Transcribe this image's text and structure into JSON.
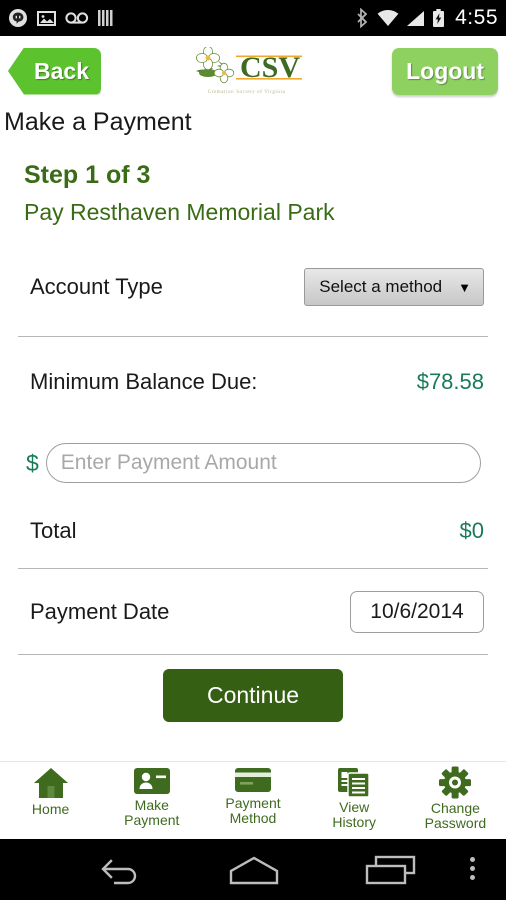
{
  "statusbar": {
    "time": "4:55",
    "left_icons": [
      "hangouts-icon",
      "image-icon",
      "voicemail-icon",
      "signal-bars-icon"
    ],
    "right_icons": [
      "bluetooth-icon",
      "wifi-icon",
      "cellular-signal-icon",
      "battery-charging-icon"
    ]
  },
  "header": {
    "back_label": "Back",
    "logout_label": "Logout",
    "logo_text": "CSV",
    "logo_subtitle": "Cremation Society of Virginia"
  },
  "page": {
    "title": "Make a Payment",
    "step": "Step 1 of 3",
    "subtitle": "Pay Resthaven Memorial Park"
  },
  "form": {
    "account_type_label": "Account Type",
    "account_type_value": "Select a method",
    "minimum_balance_label": "Minimum Balance Due:",
    "minimum_balance_value": "$78.58",
    "currency_symbol": "$",
    "amount_placeholder": "Enter Payment Amount",
    "amount_value": "",
    "total_label": "Total",
    "total_value": "$0",
    "payment_date_label": "Payment Date",
    "payment_date_value": "10/6/2014",
    "continue_label": "Continue"
  },
  "tabs": [
    {
      "label": "Home",
      "icon": "home-icon"
    },
    {
      "label": "Make\nPayment",
      "icon": "id-card-icon"
    },
    {
      "label": "Payment\nMethod",
      "icon": "credit-card-icon"
    },
    {
      "label": "View\nHistory",
      "icon": "documents-icon"
    },
    {
      "label": "Change\nPassword",
      "icon": "gear-icon"
    }
  ],
  "tab_labels": {
    "home": "Home",
    "make_payment_l1": "Make",
    "make_payment_l2": "Payment",
    "payment_method_l1": "Payment",
    "payment_method_l2": "Method",
    "view_history_l1": "View",
    "view_history_l2": "History",
    "change_password_l1": "Change",
    "change_password_l2": "Password"
  },
  "navbar": {
    "back": "back-icon",
    "home": "home-nav-icon",
    "recents": "recents-icon",
    "menu": "overflow-menu-icon"
  },
  "colors": {
    "brand_green": "#3a6b16",
    "accent_green": "#5cc22e",
    "logout_green": "#8ed161",
    "continue_green": "#356013",
    "money_teal": "#1a7a5a"
  }
}
